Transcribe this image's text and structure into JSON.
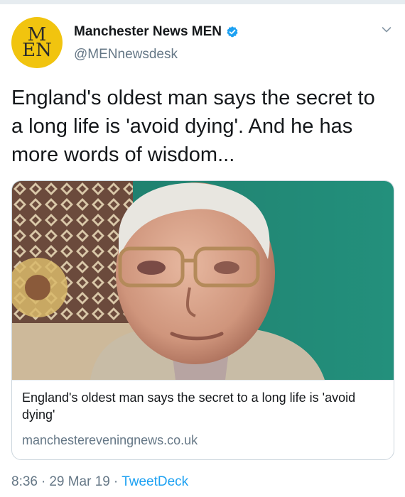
{
  "author": {
    "avatar_line1": "M",
    "avatar_line2": "EN",
    "display_name": "Manchester News MEN",
    "handle": "@MENnewsdesk"
  },
  "tweet": {
    "text": "England's oldest man says the secret to a long life is 'avoid dying'. And he has more words of wisdom..."
  },
  "card": {
    "title": "England's oldest man says the secret to a long life is 'avoid dying'",
    "domain": "manchestereveningnews.co.uk",
    "image_description_icon": "elderly-man-photo"
  },
  "meta": {
    "time": "8:36",
    "date": "29 Mar 19",
    "source": "TweetDeck",
    "separator": "·"
  },
  "colors": {
    "avatar_bg": "#f1c40f",
    "verified": "#1da1f2",
    "link": "#1da1f2",
    "secondary_text": "#657786"
  }
}
